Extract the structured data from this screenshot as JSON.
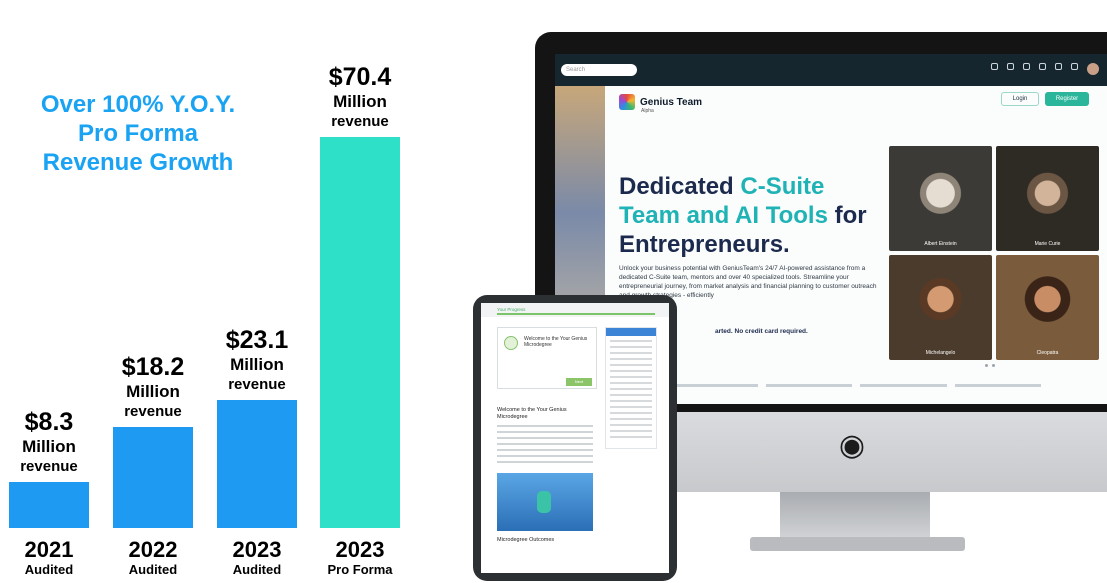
{
  "headline": {
    "line1": "Over 100% Y.O.Y.",
    "line2": "Pro Forma",
    "line3": "Revenue Growth"
  },
  "chart_data": {
    "type": "bar",
    "title": "",
    "xlabel": "",
    "ylabel": "",
    "categories": [
      "2021 Audited",
      "2022 Audited",
      "2023 Audited",
      "2023 Pro Forma"
    ],
    "values": [
      8.3,
      18.2,
      23.1,
      70.4
    ],
    "ylim": [
      0,
      80
    ],
    "grid": false,
    "bar_colors": [
      "#1e9af3",
      "#1e9af3",
      "#1e9af3",
      "#2fe0c8"
    ],
    "data_labels": [
      {
        "amount": "$8.3",
        "unit": "Million",
        "suffix": "revenue"
      },
      {
        "amount": "$18.2",
        "unit": "Million",
        "suffix": "revenue"
      },
      {
        "amount": "$23.1",
        "unit": "Million",
        "suffix": "revenue"
      },
      {
        "amount": "$70.4",
        "unit": "Million",
        "suffix": "revenue"
      }
    ],
    "year_labels": [
      {
        "year": "2021",
        "note": "Audited"
      },
      {
        "year": "2022",
        "note": "Audited"
      },
      {
        "year": "2023",
        "note": "Audited"
      },
      {
        "year": "2023",
        "note": "Pro Forma"
      }
    ]
  },
  "monitor": {
    "search_placeholder": "Search",
    "brand_name": "Genius Team",
    "brand_sub": "Alpha",
    "login_label": "Login",
    "register_label": "Register",
    "hero_part1": "Dedicated ",
    "hero_highlight1": "C-Suite",
    "hero_highlight2": "Team and AI Tools",
    "hero_part2": " for",
    "hero_part3": "Entrepreneurs.",
    "hero_description": "Unlock your business potential with GeniusTeam's 24/7 AI-powered assistance from a dedicated C-Suite team, mentors and over 40 specialized tools. Streamline your entrepreneurial journey, from market analysis and financial planning to customer outreach and growth strategies - efficiently",
    "hero_note": "arted. No credit card required.",
    "portraits": [
      "Albert Einstein",
      "Marie Curie",
      "Michelangelo",
      "Cleopatra"
    ]
  },
  "tablet": {
    "header_text": "Your Progress",
    "card_title": "Welcome to the Your Genius Microdegree",
    "card_button": "Next",
    "body_title": "Welcome to the Your Genius Microdegree",
    "footer_title": "Microdegree Outcomes"
  },
  "colors": {
    "headline": "#1aa3f2",
    "audited_bar": "#1e9af3",
    "pro_forma_bar": "#2fe0c8",
    "hero_text": "#1c2a4d",
    "hero_accent": "#1fb3b6",
    "register_button": "#2bb59a"
  },
  "icons": [
    "apple-logo-icon",
    "genius-team-logo-icon",
    "search-icon",
    "user-avatar-icon",
    "play-video-icon"
  ]
}
